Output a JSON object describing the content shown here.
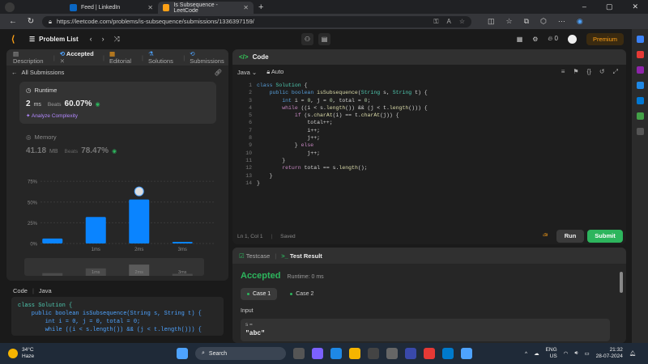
{
  "browser": {
    "tabs": [
      {
        "title": "Feed | LinkedIn",
        "active": false,
        "favicon_color": "#0a66c2"
      },
      {
        "title": "Is Subsequence - LeetCode",
        "active": true,
        "favicon_color": "#ffa116"
      }
    ],
    "url": "https://leetcode.com/problems/is-subsequence/submissions/1336397159/",
    "window_controls": [
      "–",
      "▢",
      "✕"
    ],
    "new_tab": "+"
  },
  "lc_nav": {
    "problem_list": "Problem List",
    "streak": "0",
    "premium": "Premium"
  },
  "left": {
    "tabs": [
      "Description",
      "Accepted",
      "Editorial",
      "Solutions",
      "Submissions"
    ],
    "all_submissions": "All Submissions",
    "runtime": {
      "title": "Runtime",
      "value": "2",
      "unit": "ms",
      "beats_label": "Beats",
      "beats": "60.07%",
      "analyze": "Analyze Complexity"
    },
    "memory": {
      "title": "Memory",
      "value": "41.18",
      "unit": "MB",
      "beats_label": "Beats",
      "beats": "78.47%"
    },
    "code_tabs": [
      "Code",
      "Java"
    ],
    "code_lines": [
      "class Solution {",
      "    public boolean isSubsequence(String s, String t) {",
      "        int i = 0, j = 0, total = 0;",
      "        while ((i < s.length()) && (j < t.length())) {"
    ]
  },
  "chart_data": {
    "type": "bar",
    "categories": [
      "0ms",
      "1ms",
      "2ms",
      "3ms"
    ],
    "x_tick_labels": [
      "1ms",
      "2ms",
      "3ms"
    ],
    "values": [
      6,
      32,
      53,
      2
    ],
    "highlight_index": 2,
    "ylim": [
      0,
      80
    ],
    "yticks": [
      "75%",
      "50%",
      "25%",
      "0%"
    ],
    "ytick_values": [
      75,
      50,
      25,
      0
    ],
    "bar_color": "#0a84ff",
    "overview_labels": [
      "1ms",
      "2ms",
      "3ms"
    ]
  },
  "editor": {
    "title": "Code",
    "language": "Java",
    "mode": "Auto",
    "status_pos": "Ln 1, Col 1",
    "status_saved": "Saved",
    "run": "Run",
    "submit": "Submit"
  },
  "test": {
    "tabs": [
      "Testcase",
      "Test Result"
    ],
    "status": "Accepted",
    "runtime": "Runtime: 0 ms",
    "cases": [
      "Case 1",
      "Case 2"
    ],
    "input_label": "Input",
    "var_name": "s =",
    "var_value": "\"abc\""
  },
  "taskbar": {
    "temp": "34°C",
    "weather": "Haze",
    "search": "Search",
    "lang1": "ENG",
    "lang2": "US",
    "time": "21:32",
    "date": "28-07-2024"
  },
  "colors": {
    "accent_orange": "#ffa116",
    "accepted_green": "#2db55d",
    "bar_blue": "#0a84ff"
  }
}
